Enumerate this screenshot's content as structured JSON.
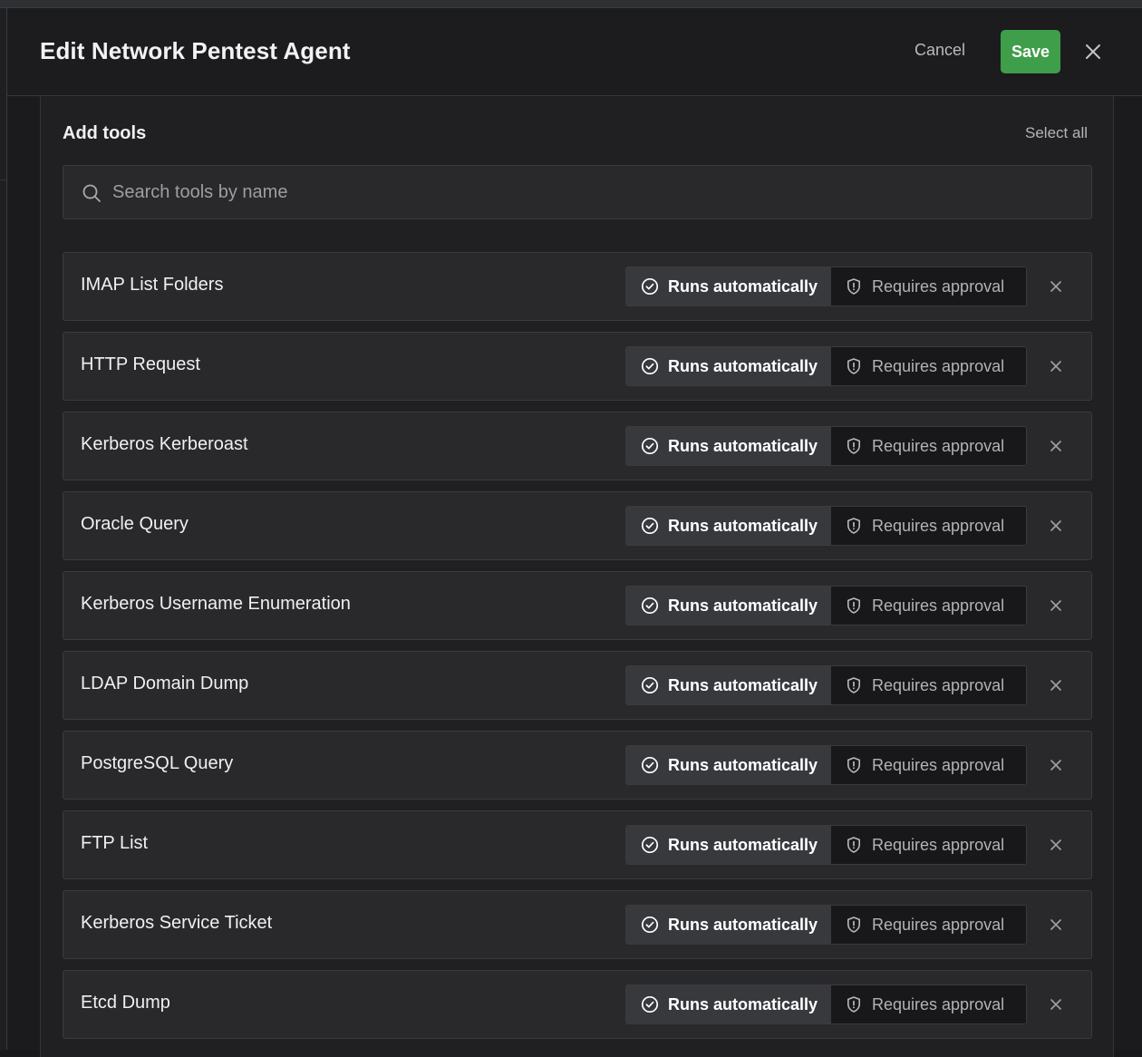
{
  "header": {
    "title": "Edit Network Pentest Agent",
    "cancel_label": "Cancel",
    "save_label": "Save"
  },
  "tools_section": {
    "title": "Add tools",
    "select_all_label": "Select all",
    "search_placeholder": "Search tools by name",
    "mode_labels": {
      "auto": "Runs automatically",
      "approval": "Requires approval"
    },
    "tools": [
      {
        "name": "IMAP List Folders",
        "mode": "auto"
      },
      {
        "name": "HTTP Request",
        "mode": "auto"
      },
      {
        "name": "Kerberos Kerberoast",
        "mode": "auto"
      },
      {
        "name": "Oracle Query",
        "mode": "auto"
      },
      {
        "name": "Kerberos Username Enumeration",
        "mode": "auto"
      },
      {
        "name": "LDAP Domain Dump",
        "mode": "auto"
      },
      {
        "name": "PostgreSQL Query",
        "mode": "auto"
      },
      {
        "name": "FTP List",
        "mode": "auto"
      },
      {
        "name": "Kerberos Service Ticket",
        "mode": "auto"
      },
      {
        "name": "Etcd Dump",
        "mode": "auto"
      }
    ]
  },
  "icons": {
    "search": "search-icon",
    "close": "close-icon",
    "auto": "check-circle-icon",
    "approval": "shield-alert-icon",
    "remove": "remove-icon"
  },
  "colors": {
    "save_button": "#3f9e4a",
    "selected_mode": "#38393d",
    "background": "#19191b"
  }
}
